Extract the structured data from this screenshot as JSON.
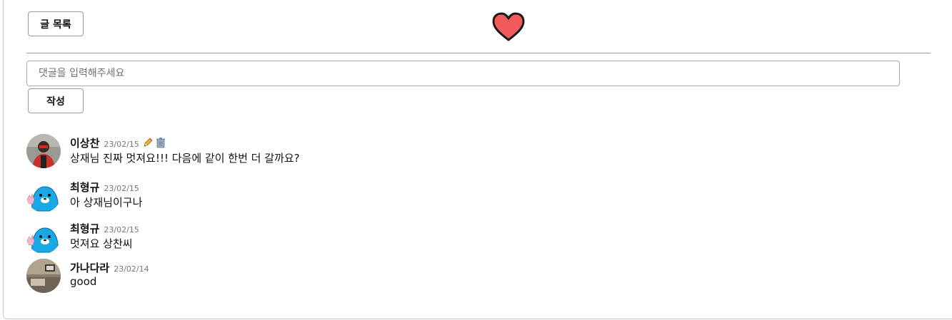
{
  "header": {
    "list_button_label": "글 목록",
    "like_icon": "heart-icon",
    "like_color": "#f25b5b"
  },
  "comment_form": {
    "placeholder": "댓글을 입력해주세요",
    "value": "",
    "submit_label": "작성"
  },
  "comments": [
    {
      "author": "이상찬",
      "date": "23/02/15",
      "text": "상재님 진짜 멋져요!!! 다음에 같이 한번 더 갈까요?",
      "avatar": "person-red-photo",
      "editable": true
    },
    {
      "author": "최형규",
      "date": "23/02/15",
      "text": "아 상재님이구나",
      "avatar": "blue-seal-character"
    },
    {
      "author": "최형규",
      "date": "23/02/15",
      "text": "멋져요 상찬씨",
      "avatar": "blue-seal-character"
    },
    {
      "author": "가나다라",
      "date": "23/02/14",
      "text": "good",
      "avatar": "room-photo"
    }
  ]
}
